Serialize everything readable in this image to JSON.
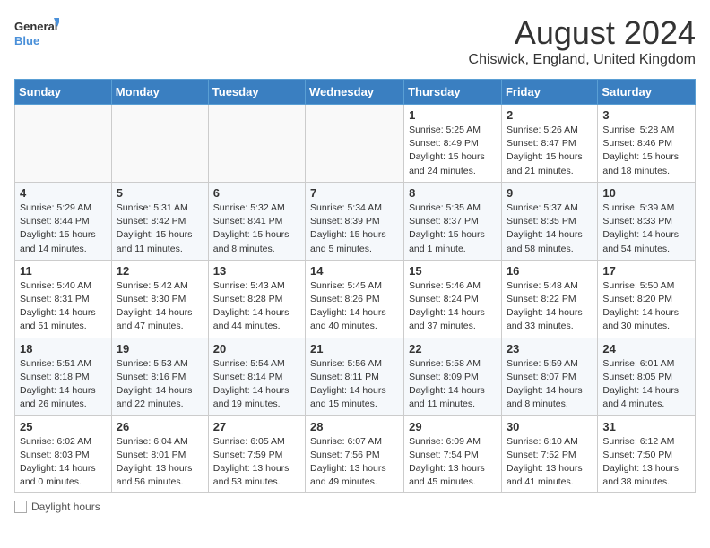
{
  "header": {
    "logo_line1": "General",
    "logo_line2": "Blue",
    "month_title": "August 2024",
    "subtitle": "Chiswick, England, United Kingdom"
  },
  "columns": [
    "Sunday",
    "Monday",
    "Tuesday",
    "Wednesday",
    "Thursday",
    "Friday",
    "Saturday"
  ],
  "weeks": [
    [
      {
        "day": "",
        "info": ""
      },
      {
        "day": "",
        "info": ""
      },
      {
        "day": "",
        "info": ""
      },
      {
        "day": "",
        "info": ""
      },
      {
        "day": "1",
        "info": "Sunrise: 5:25 AM\nSunset: 8:49 PM\nDaylight: 15 hours\nand 24 minutes."
      },
      {
        "day": "2",
        "info": "Sunrise: 5:26 AM\nSunset: 8:47 PM\nDaylight: 15 hours\nand 21 minutes."
      },
      {
        "day": "3",
        "info": "Sunrise: 5:28 AM\nSunset: 8:46 PM\nDaylight: 15 hours\nand 18 minutes."
      }
    ],
    [
      {
        "day": "4",
        "info": "Sunrise: 5:29 AM\nSunset: 8:44 PM\nDaylight: 15 hours\nand 14 minutes."
      },
      {
        "day": "5",
        "info": "Sunrise: 5:31 AM\nSunset: 8:42 PM\nDaylight: 15 hours\nand 11 minutes."
      },
      {
        "day": "6",
        "info": "Sunrise: 5:32 AM\nSunset: 8:41 PM\nDaylight: 15 hours\nand 8 minutes."
      },
      {
        "day": "7",
        "info": "Sunrise: 5:34 AM\nSunset: 8:39 PM\nDaylight: 15 hours\nand 5 minutes."
      },
      {
        "day": "8",
        "info": "Sunrise: 5:35 AM\nSunset: 8:37 PM\nDaylight: 15 hours\nand 1 minute."
      },
      {
        "day": "9",
        "info": "Sunrise: 5:37 AM\nSunset: 8:35 PM\nDaylight: 14 hours\nand 58 minutes."
      },
      {
        "day": "10",
        "info": "Sunrise: 5:39 AM\nSunset: 8:33 PM\nDaylight: 14 hours\nand 54 minutes."
      }
    ],
    [
      {
        "day": "11",
        "info": "Sunrise: 5:40 AM\nSunset: 8:31 PM\nDaylight: 14 hours\nand 51 minutes."
      },
      {
        "day": "12",
        "info": "Sunrise: 5:42 AM\nSunset: 8:30 PM\nDaylight: 14 hours\nand 47 minutes."
      },
      {
        "day": "13",
        "info": "Sunrise: 5:43 AM\nSunset: 8:28 PM\nDaylight: 14 hours\nand 44 minutes."
      },
      {
        "day": "14",
        "info": "Sunrise: 5:45 AM\nSunset: 8:26 PM\nDaylight: 14 hours\nand 40 minutes."
      },
      {
        "day": "15",
        "info": "Sunrise: 5:46 AM\nSunset: 8:24 PM\nDaylight: 14 hours\nand 37 minutes."
      },
      {
        "day": "16",
        "info": "Sunrise: 5:48 AM\nSunset: 8:22 PM\nDaylight: 14 hours\nand 33 minutes."
      },
      {
        "day": "17",
        "info": "Sunrise: 5:50 AM\nSunset: 8:20 PM\nDaylight: 14 hours\nand 30 minutes."
      }
    ],
    [
      {
        "day": "18",
        "info": "Sunrise: 5:51 AM\nSunset: 8:18 PM\nDaylight: 14 hours\nand 26 minutes."
      },
      {
        "day": "19",
        "info": "Sunrise: 5:53 AM\nSunset: 8:16 PM\nDaylight: 14 hours\nand 22 minutes."
      },
      {
        "day": "20",
        "info": "Sunrise: 5:54 AM\nSunset: 8:14 PM\nDaylight: 14 hours\nand 19 minutes."
      },
      {
        "day": "21",
        "info": "Sunrise: 5:56 AM\nSunset: 8:11 PM\nDaylight: 14 hours\nand 15 minutes."
      },
      {
        "day": "22",
        "info": "Sunrise: 5:58 AM\nSunset: 8:09 PM\nDaylight: 14 hours\nand 11 minutes."
      },
      {
        "day": "23",
        "info": "Sunrise: 5:59 AM\nSunset: 8:07 PM\nDaylight: 14 hours\nand 8 minutes."
      },
      {
        "day": "24",
        "info": "Sunrise: 6:01 AM\nSunset: 8:05 PM\nDaylight: 14 hours\nand 4 minutes."
      }
    ],
    [
      {
        "day": "25",
        "info": "Sunrise: 6:02 AM\nSunset: 8:03 PM\nDaylight: 14 hours\nand 0 minutes."
      },
      {
        "day": "26",
        "info": "Sunrise: 6:04 AM\nSunset: 8:01 PM\nDaylight: 13 hours\nand 56 minutes."
      },
      {
        "day": "27",
        "info": "Sunrise: 6:05 AM\nSunset: 7:59 PM\nDaylight: 13 hours\nand 53 minutes."
      },
      {
        "day": "28",
        "info": "Sunrise: 6:07 AM\nSunset: 7:56 PM\nDaylight: 13 hours\nand 49 minutes."
      },
      {
        "day": "29",
        "info": "Sunrise: 6:09 AM\nSunset: 7:54 PM\nDaylight: 13 hours\nand 45 minutes."
      },
      {
        "day": "30",
        "info": "Sunrise: 6:10 AM\nSunset: 7:52 PM\nDaylight: 13 hours\nand 41 minutes."
      },
      {
        "day": "31",
        "info": "Sunrise: 6:12 AM\nSunset: 7:50 PM\nDaylight: 13 hours\nand 38 minutes."
      }
    ]
  ],
  "footer": {
    "daylight_label": "Daylight hours"
  }
}
